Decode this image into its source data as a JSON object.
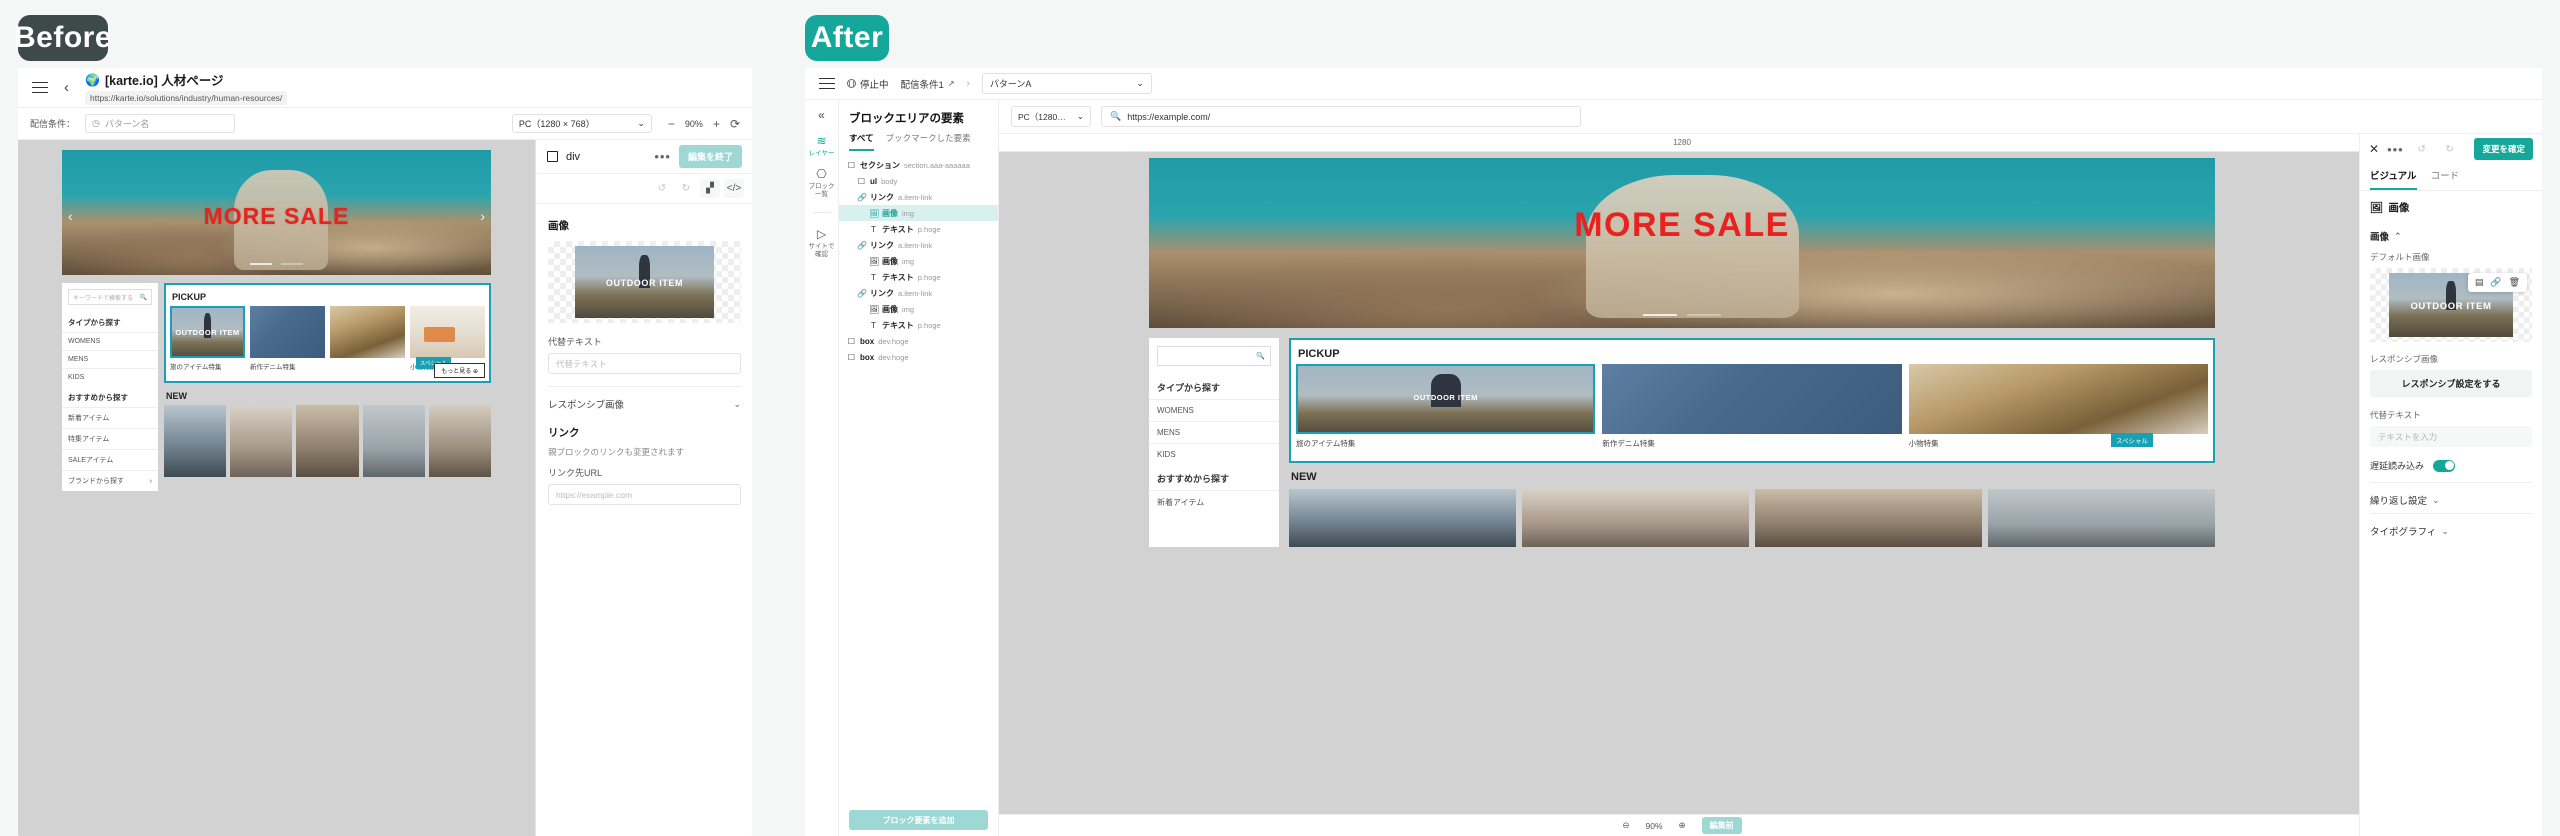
{
  "badges": {
    "before": "Before",
    "after": "After"
  },
  "before": {
    "header": {
      "menu_icon": "hamburger-icon",
      "back_icon": "chevron-left-icon",
      "globe_icon": "globe-icon",
      "title": "[karte.io] 人材ページ",
      "url": "https://karte.io/solutions/industry/human-resources/"
    },
    "toolbar": {
      "condition_label": "配信条件：",
      "pattern_placeholder": "パターン名",
      "pattern_icon": "clock-icon",
      "device": "PC（1280 × 768）",
      "zoom_out": "−",
      "zoom_level": "90%",
      "zoom_in": "+",
      "reload_icon": "reload-icon"
    },
    "preview": {
      "hero_text": "MORE SALE",
      "sidebar": {
        "search_placeholder": "キーワードで検索する",
        "heading": "タイプから探す",
        "items": [
          "WOMENS",
          "MENS",
          "KIDS"
        ],
        "heading2": "おすすめから探す",
        "items2": [
          "新着アイテム",
          "特集アイテム",
          "SALEアイテム"
        ],
        "footer": "ブランドから探す"
      },
      "pickup_title": "PICKUP",
      "cards": [
        {
          "overlay": "OUTDOOR ITEM",
          "caption": "旅のアイテム特集"
        },
        {
          "overlay": "",
          "caption": "新作デニム特集"
        },
        {
          "overlay": "",
          "caption": "小物特集"
        }
      ],
      "special_badge": "スペシャル",
      "more_button": "もっと見る ⊕",
      "new_title": "NEW"
    },
    "panel": {
      "element_tag": "div",
      "element_icon": "square-icon",
      "more_icon": "ellipsis-icon",
      "finish_button": "編集を終了",
      "undo_icon": "undo-icon",
      "redo_icon": "redo-icon",
      "blocks_icon": "add-block-icon",
      "code_icon": "code-icon",
      "image_heading": "画像",
      "image_overlay": "OUTDOOR ITEM",
      "alt_label": "代替テキスト",
      "alt_placeholder": "代替テキスト",
      "responsive_label": "レスポンシブ画像",
      "responsive_chevron": "chevron-down-icon",
      "link_heading": "リンク",
      "link_note": "親ブロックのリンクも変更されます",
      "link_url_label": "リンク先URL",
      "link_url_placeholder": "https://example.com"
    }
  },
  "after": {
    "header": {
      "menu_icon": "hamburger-icon",
      "status": "停止中",
      "status_icon": "pause-icon",
      "condition": "配信条件1",
      "external_icon": "external-link-icon",
      "separator": "›",
      "pattern": "パターンA",
      "pattern_chevron": "chevron-down-icon"
    },
    "rail": {
      "collapse_icon": "collapse-left-icon",
      "items": [
        {
          "icon": "layers-icon",
          "label": "レイヤー",
          "active": true
        },
        {
          "icon": "blocks-icon",
          "label": "ブロック\n一覧",
          "active": false
        },
        {
          "icon": "play-icon",
          "label": "サイトで\n確認",
          "active": false
        }
      ]
    },
    "layers": {
      "title": "ブロックエリアの要素",
      "tabs": [
        {
          "label": "すべて",
          "active": true
        },
        {
          "label": "ブックマークした要素",
          "active": false
        }
      ],
      "tree": [
        {
          "indent": 0,
          "icon": "square-icon",
          "name": "セクション",
          "sub": "section.aaa-aaaaaa",
          "selected": false
        },
        {
          "indent": 1,
          "icon": "square-icon",
          "name": "ul",
          "sub": "body",
          "selected": false
        },
        {
          "indent": 1,
          "icon": "link-icon",
          "name": "リンク",
          "sub": "a.item-link",
          "selected": false
        },
        {
          "indent": 2,
          "icon": "image-icon",
          "name": "画像",
          "sub": "img",
          "selected": true
        },
        {
          "indent": 2,
          "icon": "text-icon",
          "name": "テキスト",
          "sub": "p.hoge",
          "selected": false
        },
        {
          "indent": 1,
          "icon": "link-icon",
          "name": "リンク",
          "sub": "a.item-link",
          "selected": false
        },
        {
          "indent": 2,
          "icon": "image-icon",
          "name": "画像",
          "sub": "img",
          "selected": false
        },
        {
          "indent": 2,
          "icon": "text-icon",
          "name": "テキスト",
          "sub": "p.hoge",
          "selected": false
        },
        {
          "indent": 1,
          "icon": "link-icon",
          "name": "リンク",
          "sub": "a.item-link",
          "selected": false
        },
        {
          "indent": 2,
          "icon": "image-icon",
          "name": "画像",
          "sub": "img",
          "selected": false
        },
        {
          "indent": 2,
          "icon": "text-icon",
          "name": "テキスト",
          "sub": "p.hoge",
          "selected": false
        },
        {
          "indent": 0,
          "icon": "square-icon",
          "name": "box",
          "sub": "dev.hoge",
          "selected": false
        },
        {
          "indent": 0,
          "icon": "square-icon",
          "name": "box",
          "sub": "dev.hoge",
          "selected": false
        }
      ],
      "add_button": "ブロック要素を追加"
    },
    "preview_bar": {
      "device": "PC（1280…",
      "device_chevron": "chevron-down-icon",
      "search_icon": "search-icon",
      "url": "https://example.com/"
    },
    "preview": {
      "ruler": "1280",
      "hero_text": "MORE SALE",
      "search_icon": "search-icon",
      "pickup_title": "PICKUP",
      "cards": [
        {
          "overlay": "OUTDOOR ITEM",
          "caption": "旅のアイテム特集"
        },
        {
          "overlay": "",
          "caption": "新作デニム特集"
        },
        {
          "overlay": "",
          "caption": "小物特集"
        }
      ],
      "special_badge": "スペシャル",
      "new_title": "NEW",
      "footer_zoom_icon": "zoom-icon",
      "footer_zoom": "90%",
      "footer_plus_icon": "plus-icon",
      "footer_button": "編集前"
    },
    "props": {
      "close_icon": "close-icon",
      "more_icon": "ellipsis-icon",
      "undo_icon": "undo-icon",
      "redo_icon": "redo-icon",
      "confirm_button": "変更を確定",
      "tabs": [
        {
          "label": "ビジュアル",
          "active": true
        },
        {
          "label": "コード",
          "active": false
        }
      ],
      "heading_icon": "image-icon",
      "heading": "画像",
      "section_image": "画像",
      "section_chevron": "chevron-up-icon",
      "default_image_label": "デフォルト画像",
      "image_overlay": "OUTDOOR ITEM",
      "image_tools": [
        {
          "icon": "replace-icon"
        },
        {
          "icon": "link-icon"
        },
        {
          "icon": "trash-icon"
        }
      ],
      "responsive_label": "レスポンシブ画像",
      "responsive_button": "レスポンシブ設定をする",
      "alt_label": "代替テキスト",
      "alt_placeholder": "テキストを入力",
      "lazy_label": "遅延読み込み",
      "lazy_on": true,
      "accordions": [
        {
          "label": "繰り返し設定",
          "chevron": "chevron-down-icon"
        },
        {
          "label": "タイポグラフィ",
          "chevron": "chevron-down-icon"
        }
      ]
    }
  },
  "colors": {
    "teal": "#15a79a",
    "teal_light": "#9ed8d5",
    "dark": "#3e4a49",
    "red": "#e8231f"
  }
}
